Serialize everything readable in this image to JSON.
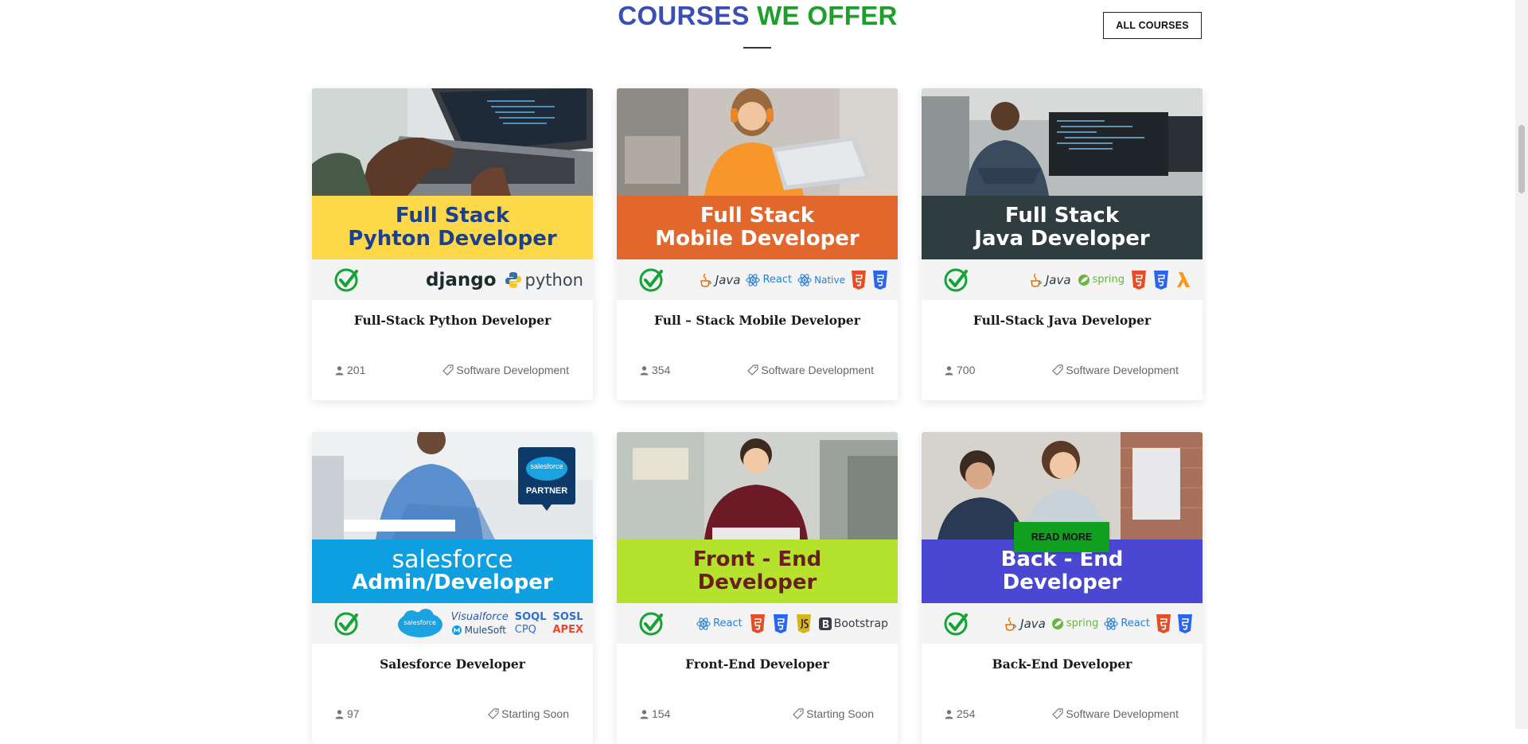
{
  "section": {
    "title_part1": "COURSES",
    "title_part2": "WE OFFER",
    "all_courses_label": "ALL COURSES"
  },
  "colors": {
    "title_blue": "#3a4fb5",
    "title_green": "#1e9e2a",
    "read_more_green": "#10a020"
  },
  "courses": [
    {
      "banner_line1": "Full Stack",
      "banner_line2": "Pyhton Developer",
      "banner_color": "#fdd94a",
      "banner_text_color": "#1d3f8f",
      "techs": [
        "django",
        "python"
      ],
      "title": "Full-Stack Python Developer",
      "students": "201",
      "category": "Software Development"
    },
    {
      "banner_line1": "Full Stack",
      "banner_line2": "Mobile Developer",
      "banner_color": "#e2672c",
      "banner_text_color": "#ffffff",
      "techs": [
        "Java",
        "React",
        "Native"
      ],
      "title": "Full – Stack Mobile Developer",
      "students": "354",
      "category": "Software Development"
    },
    {
      "banner_line1": "Full Stack",
      "banner_line2": "Java Developer",
      "banner_color": "#2f3c40",
      "banner_text_color": "#ffffff",
      "techs": [
        "Java",
        "spring"
      ],
      "title": "Full-Stack Java Developer",
      "students": "700",
      "category": "Software Development"
    },
    {
      "banner_line1": "salesforce",
      "banner_line2": "Admin/Developer",
      "banner_color": "#0d9fe0",
      "banner_text_color": "#ffffff",
      "techs": [
        "salesforce",
        "Visualforce",
        "SOQL",
        "SOSL",
        "MuleSoft",
        "CPQ",
        "APEX"
      ],
      "partner_badge_line1": "salesforce",
      "partner_badge_line2": "PARTNER",
      "title": "Salesforce Developer",
      "students": "97",
      "category": "Starting Soon"
    },
    {
      "banner_line1": "Front - End",
      "banner_line2": "Developer",
      "banner_color": "#b5e22c",
      "banner_text_color": "#6b1e1e",
      "techs": [
        "React",
        "Bootstrap"
      ],
      "title": "Front-End Developer",
      "students": "154",
      "category": "Starting Soon"
    },
    {
      "banner_line1": "Back - End",
      "banner_line2": "Developer",
      "banner_color": "#4a48d2",
      "banner_text_color": "#ffffff",
      "techs": [
        "Java",
        "spring",
        "React"
      ],
      "title": "Back-End Developer",
      "students": "254",
      "category": "Software Development",
      "read_more_label": "READ MORE"
    }
  ]
}
